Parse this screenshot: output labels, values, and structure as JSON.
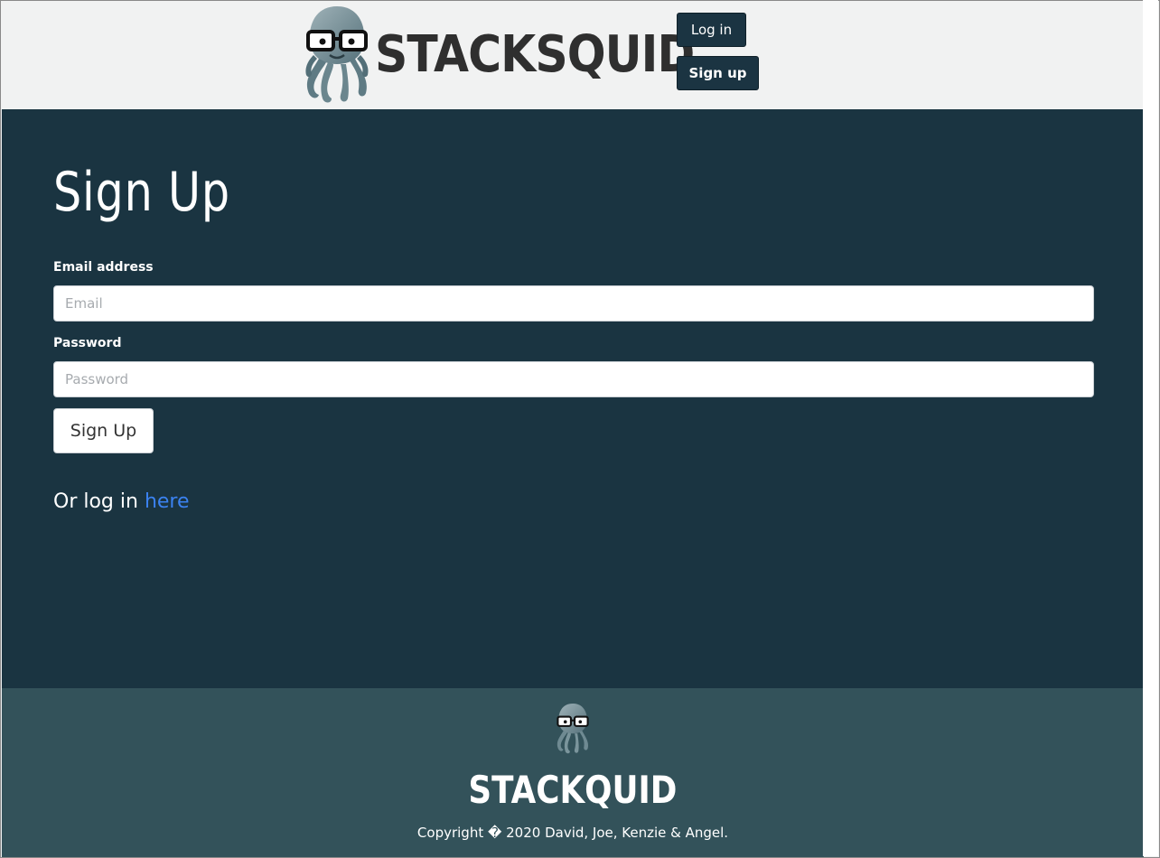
{
  "header": {
    "brand": "STACKSQUID",
    "login_label": "Log in",
    "signup_label": "Sign up"
  },
  "form": {
    "title": "Sign Up",
    "email_label": "Email address",
    "email_placeholder": "Email",
    "email_value": "",
    "password_label": "Password",
    "password_placeholder": "Password",
    "password_value": "",
    "submit_label": "Sign Up",
    "alt_prefix": "Or log in ",
    "alt_link": "here"
  },
  "footer": {
    "brand": "STACKQUID",
    "copyright": "Copyright � 2020 David, Joe, Kenzie & Angel."
  },
  "colors": {
    "header_bg": "#f1f2f2",
    "main_bg": "#1a3441",
    "footer_bg": "#33525a",
    "button_bg": "#1b3442",
    "link": "#3b82f0"
  },
  "icons": {
    "logo": "squid-with-glasses-icon"
  }
}
